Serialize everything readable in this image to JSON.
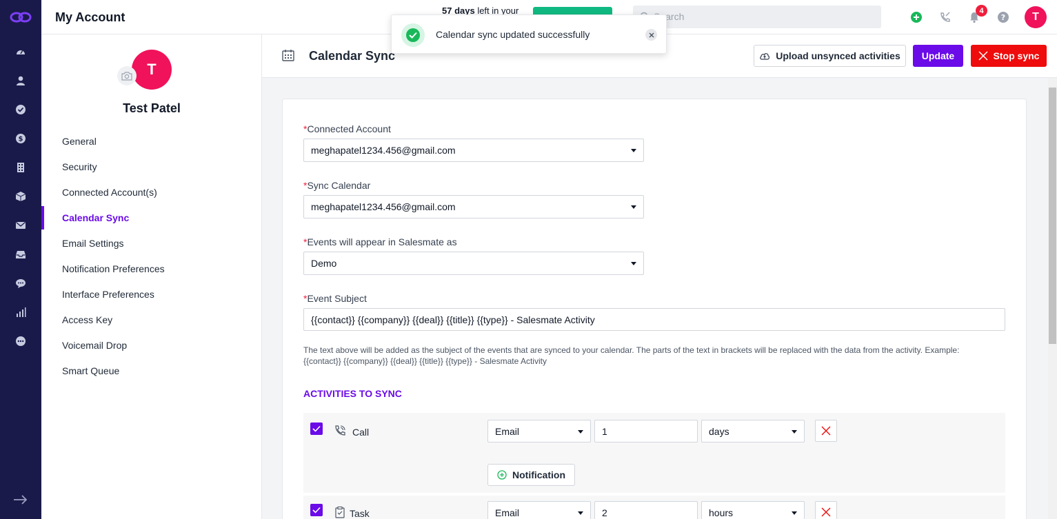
{
  "header": {
    "title": "My Account",
    "trial_days": "57 days",
    "trial_suffix": " left in your",
    "search_placeholder": "Search",
    "notification_count": "4",
    "user_initial": "T"
  },
  "toast": {
    "message": "Calendar sync updated successfully"
  },
  "profile": {
    "initial": "T",
    "name": "Test Patel"
  },
  "sidebar": {
    "items": [
      {
        "label": "General"
      },
      {
        "label": "Security"
      },
      {
        "label": "Connected Account(s)"
      },
      {
        "label": "Calendar Sync",
        "active": true
      },
      {
        "label": "Email Settings"
      },
      {
        "label": "Notification Preferences"
      },
      {
        "label": "Interface Preferences"
      },
      {
        "label": "Access Key"
      },
      {
        "label": "Voicemail Drop"
      },
      {
        "label": "Smart Queue"
      }
    ]
  },
  "page": {
    "title": "Calendar Sync",
    "upload_label": "Upload unsynced activities",
    "update_label": "Update",
    "stop_label": "Stop sync"
  },
  "form": {
    "connected_account": {
      "label": "Connected Account",
      "value": "meghapatel1234.456@gmail.com"
    },
    "sync_calendar": {
      "label": "Sync Calendar",
      "value": "meghapatel1234.456@gmail.com"
    },
    "events_appear": {
      "label": "Events will appear in Salesmate as",
      "value": "Demo"
    },
    "event_subject": {
      "label": "Event Subject",
      "value": "{{contact}} {{company}} {{deal}} {{title}} {{type}} - Salesmate Activity"
    },
    "help_text": "The text above will be added as the subject of the events that are synced to your calendar. The parts of the text in brackets will be replaced with the data from the activity. Example: {{contact}} {{company}} {{deal}} {{title}} {{type}} - Salesmate Activity",
    "required_mark": "*"
  },
  "activities": {
    "section_title": "ACTIVITIES TO SYNC",
    "notification_label": "Notification",
    "rows": [
      {
        "name": "Call",
        "channel": "Email",
        "amount": "1",
        "unit": "days"
      },
      {
        "name": "Task",
        "channel": "Email",
        "amount": "2",
        "unit": "hours"
      }
    ]
  },
  "colors": {
    "brand": "#6a0be8",
    "danger": "#ee0c0c",
    "avatar": "#f0125b",
    "rail": "#1a1a4a"
  }
}
